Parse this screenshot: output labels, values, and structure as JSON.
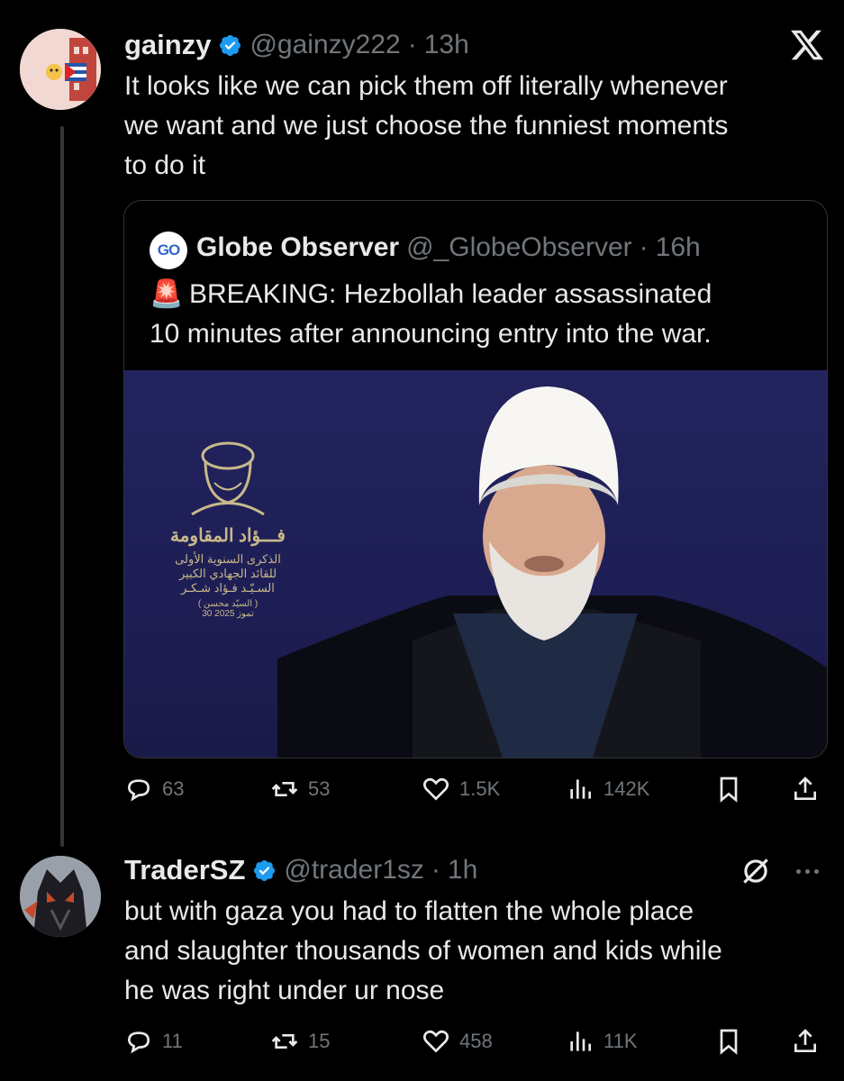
{
  "tweet1": {
    "display_name": "gainzy",
    "handle": "@gainzy222",
    "separator": "·",
    "time": "13h",
    "text_lines": [
      "It looks like we can pick them off literally whenever",
      "we want and we just choose the funniest moments",
      "to do it"
    ],
    "logo": "X",
    "quoted": {
      "display_name": "Globe Observer",
      "handle": "@_GlobeObserver",
      "separator": "·",
      "time": "16h",
      "avatar_text": "GO",
      "emoji": "🚨",
      "text_lines": [
        "BREAKING: Hezbollah leader assassinated",
        "10 minutes after announcing entry into the war."
      ],
      "banner_text": {
        "line1": "فـــؤاد المقاومة",
        "line2": "الذكرى السنوية الأولى",
        "line3": "للقائد الجهادي الكبير",
        "line4": "السـيّـد فـؤاد شـكـر",
        "line5": "( السيّد محسن )",
        "line6": "30 تموز 2025"
      }
    },
    "actions": {
      "replies": "63",
      "reposts": "53",
      "likes": "1.5K",
      "views": "142K"
    }
  },
  "tweet2": {
    "display_name": "TraderSZ",
    "handle": "@trader1sz",
    "separator": "·",
    "time": "1h",
    "text_lines": [
      "but with gaza you had to flatten the whole place",
      "and slaughter thousands of women and kids while",
      "he was right under ur nose"
    ],
    "actions": {
      "replies": "11",
      "reposts": "15",
      "likes": "458",
      "views": "11K"
    }
  },
  "colors": {
    "background": "#000000",
    "text": "#e7e9ea",
    "secondary": "#71767b",
    "verified": "#1d9bf0",
    "border": "#2f3336",
    "video_bg": "#1f1f57"
  }
}
